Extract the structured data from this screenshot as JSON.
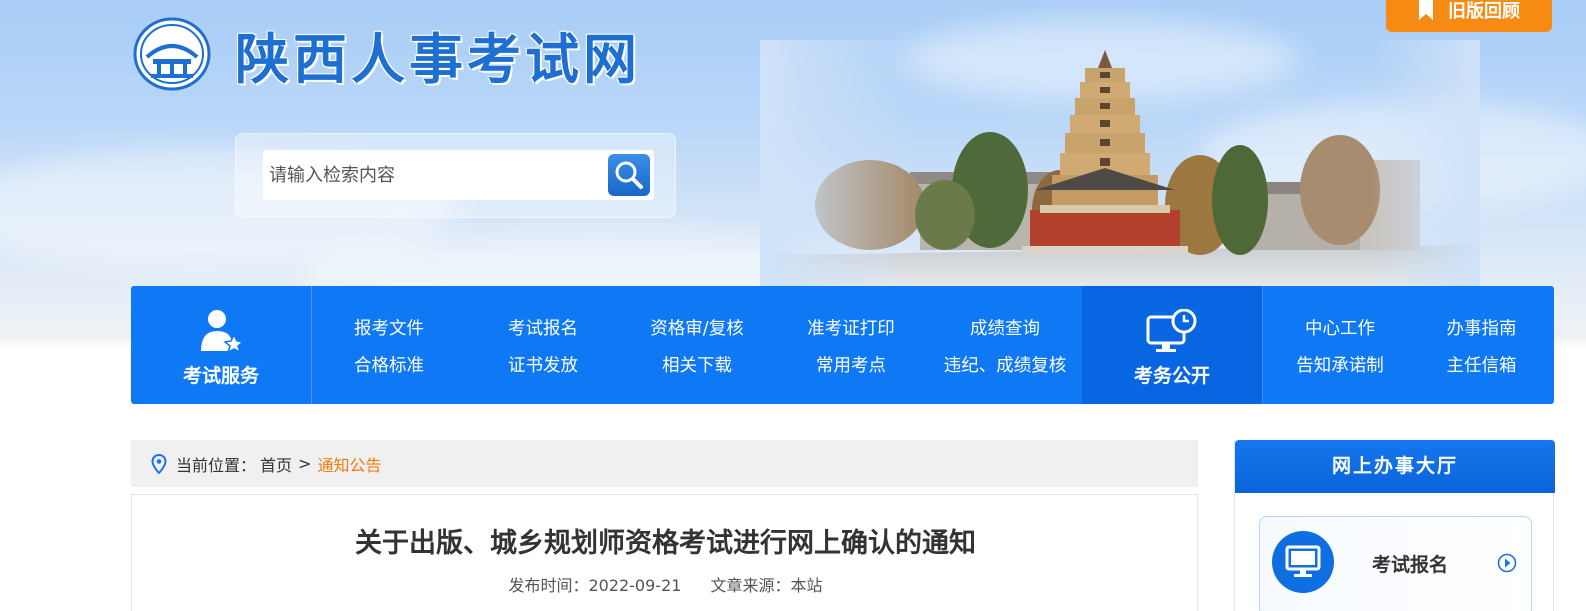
{
  "site": {
    "title": "陕西人事考试网",
    "old_version_label": "旧版回顾"
  },
  "search": {
    "placeholder": "请输入检索内容"
  },
  "nav": {
    "service_title": "考试服务",
    "public_title": "考务公开",
    "service_links": [
      "报考文件",
      "考试报名",
      "资格审/复核",
      "准考证打印",
      "成绩查询",
      "合格标准",
      "证书发放",
      "相关下载",
      "常用考点",
      "违纪、成绩复核"
    ],
    "public_links": [
      "中心工作",
      "办事指南",
      "告知承诺制",
      "主任信箱"
    ]
  },
  "breadcrumb": {
    "label": "当前位置：",
    "home": "首页",
    "separator": ">",
    "current": "通知公告"
  },
  "article": {
    "title": "关于出版、城乡规划师资格考试进行网上确认的通知",
    "publish_time": "发布时间：2022-09-21",
    "source": "文章来源：本站"
  },
  "hall": {
    "title": "网上办事大厅",
    "items": [
      {
        "label": "考试报名",
        "icon": "monitor-icon"
      }
    ]
  },
  "colors": {
    "brand_blue": "#0f78f5",
    "accent_orange": "#f78a12",
    "breadcrumb_current": "#f27b0f"
  }
}
